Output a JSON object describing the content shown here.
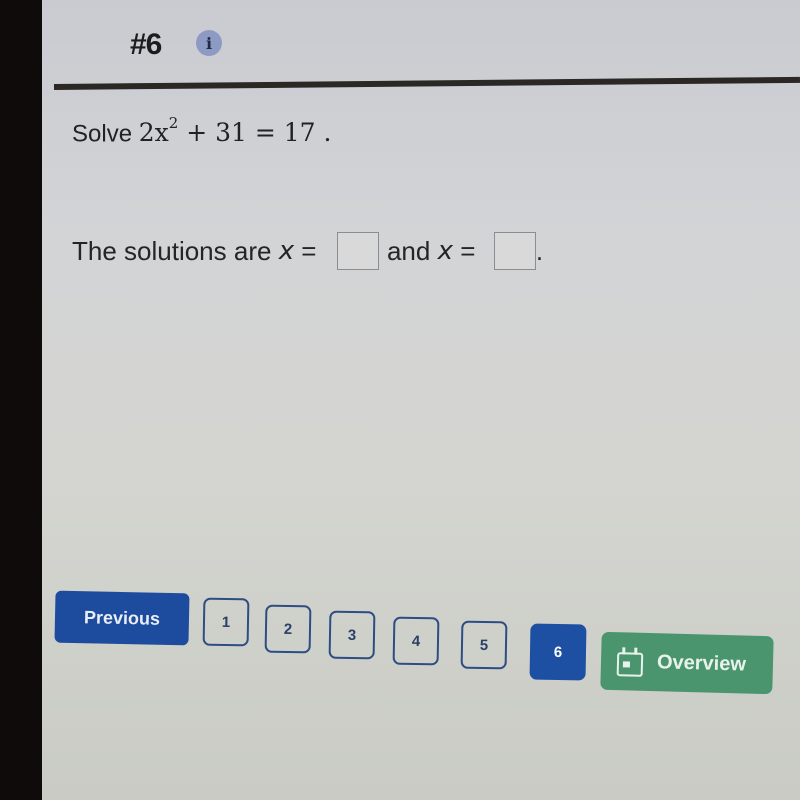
{
  "header": {
    "question_number": "#6",
    "info_icon": "info-icon",
    "info_glyph": "i"
  },
  "problem": {
    "prefix": "Solve",
    "equation_base": "2x",
    "equation_exponent": "2",
    "equation_rest": " + 31 = 17 .",
    "full_text": "Solve 2x^2 + 31 = 17 ."
  },
  "answer": {
    "lead_text": "The solutions are",
    "var1": "x",
    "equals1": " = ",
    "connector": "and",
    "var2": "x",
    "equals2": " = ",
    "trailing": ".",
    "answer1_value": "",
    "answer2_value": ""
  },
  "navigation": {
    "previous_label": "Previous",
    "pages": [
      "1",
      "2",
      "3",
      "4",
      "5",
      "6"
    ],
    "current_page": "6",
    "overview_label": "Overview",
    "overview_icon": "calendar-icon"
  },
  "colors": {
    "primary_blue": "#1d4fa3",
    "overview_green": "#4a956d",
    "page_border": "#2d4d83"
  }
}
